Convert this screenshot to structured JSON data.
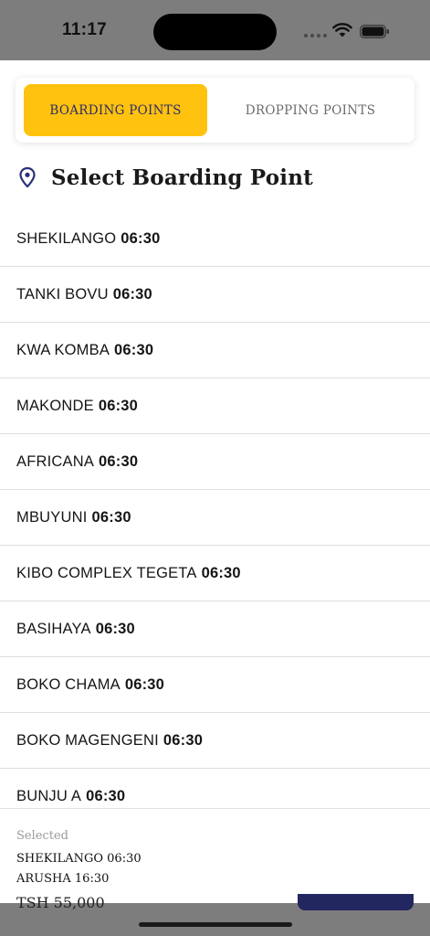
{
  "status_bar": {
    "time": "11:17"
  },
  "tabs": {
    "boarding": "BOARDING POINTS",
    "dropping": "DROPPING POINTS",
    "active": "boarding",
    "active_color": "#ffc20e"
  },
  "heading": {
    "icon": "location-pin-icon",
    "title": "Select Boarding Point"
  },
  "boarding_points": [
    {
      "name": "SHEKILANGO",
      "time": "06:30"
    },
    {
      "name": "TANKI BOVU",
      "time": "06:30"
    },
    {
      "name": "KWA KOMBA",
      "time": "06:30"
    },
    {
      "name": "MAKONDE",
      "time": "06:30"
    },
    {
      "name": "AFRICANA",
      "time": "06:30"
    },
    {
      "name": "MBUYUNI",
      "time": "06:30"
    },
    {
      "name": "KIBO COMPLEX TEGETA",
      "time": "06:30"
    },
    {
      "name": "BASIHAYA",
      "time": "06:30"
    },
    {
      "name": "BOKO CHAMA",
      "time": "06:30"
    },
    {
      "name": "BOKO MAGENGENI",
      "time": "06:30"
    },
    {
      "name": "BUNJU A",
      "time": "06:30"
    }
  ],
  "selected": {
    "label": "Selected",
    "boarding": "SHEKILANGO 06:30",
    "dropping": "ARUSHA 16:30"
  },
  "behind": {
    "price": "TSH 55,000"
  }
}
